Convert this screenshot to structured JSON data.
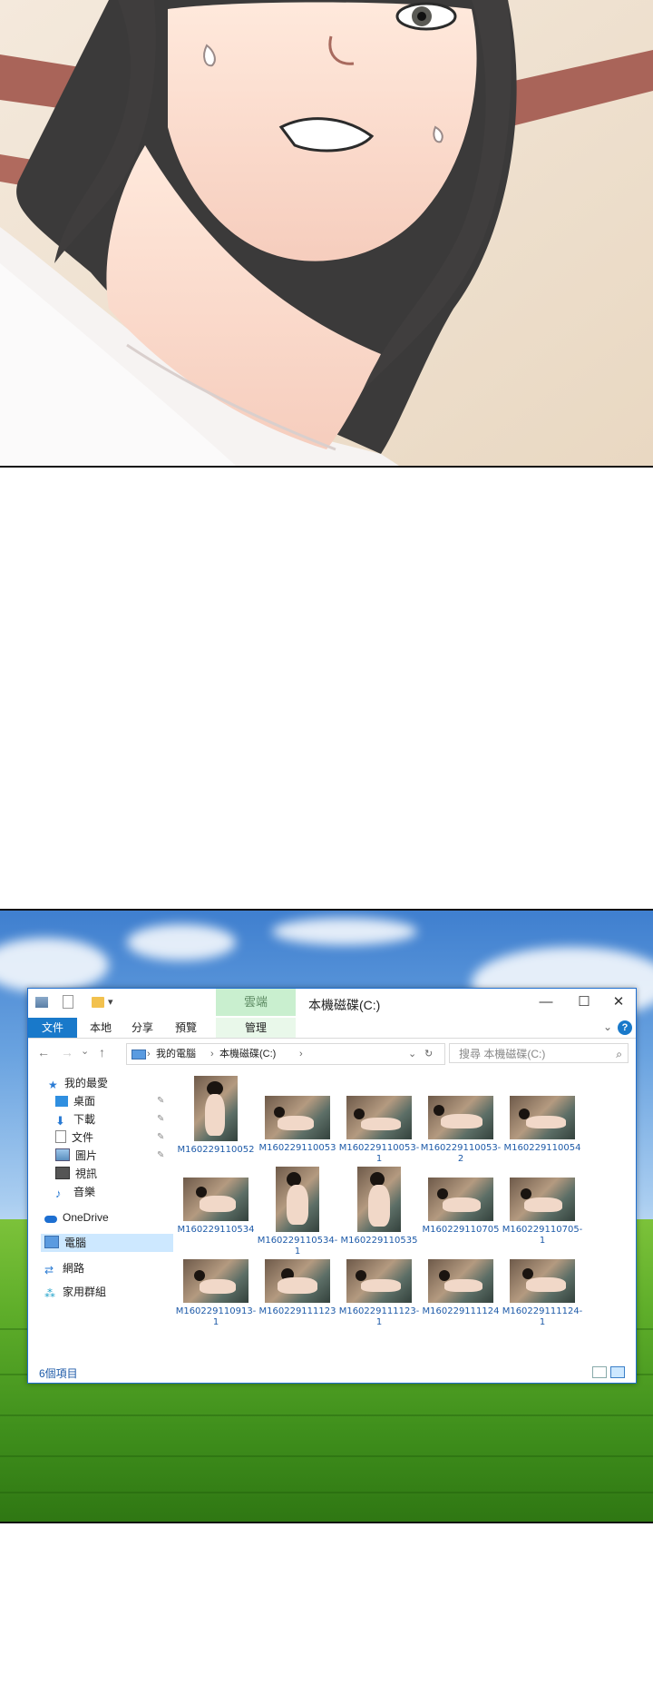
{
  "explorer": {
    "context_tab": "雲端",
    "title": "本機磁碟(C:)",
    "window_buttons": {
      "minimize": "—",
      "maximize": "☐",
      "close": "✕"
    },
    "ribbon_tabs": {
      "file": "文件",
      "home": "本地",
      "share": "分享",
      "view": "預覽",
      "manage": "管理"
    },
    "nav_back": "←",
    "nav_forward": "→",
    "nav_recent": "⌄",
    "nav_up": "↑",
    "breadcrumb": [
      "我的電腦",
      "本機磁碟(C:)"
    ],
    "search_placeholder": "搜尋 本機磁碟(C:)",
    "sidebar": {
      "favorites": "我的最愛",
      "quick": [
        {
          "label": "桌面",
          "icon": "desktop-icon",
          "pinned": true
        },
        {
          "label": "下載",
          "icon": "download-icon",
          "pinned": true
        },
        {
          "label": "文件",
          "icon": "document-icon",
          "pinned": true
        },
        {
          "label": "圖片",
          "icon": "picture-icon",
          "pinned": true
        },
        {
          "label": "視訊",
          "icon": "video-icon",
          "pinned": false
        },
        {
          "label": "音樂",
          "icon": "music-icon",
          "pinned": false
        }
      ],
      "onedrive": "OneDrive",
      "this_pc": "電腦",
      "network": "網路",
      "homegroup": "家用群組"
    },
    "files": [
      {
        "name": "M160229110052",
        "tall": true
      },
      {
        "name": "M160229110053",
        "tall": false
      },
      {
        "name": "M160229110053-1",
        "tall": false
      },
      {
        "name": "M160229110053-2",
        "tall": false
      },
      {
        "name": "M160229110054",
        "tall": false
      },
      {
        "name": "M160229110534",
        "tall": false
      },
      {
        "name": "M160229110534-1",
        "tall": true
      },
      {
        "name": "M160229110535",
        "tall": true
      },
      {
        "name": "M160229110705",
        "tall": false
      },
      {
        "name": "M160229110705-1",
        "tall": false
      },
      {
        "name": "M160229110913-1",
        "tall": false
      },
      {
        "name": "M160229111123",
        "tall": false
      },
      {
        "name": "M160229111123-1",
        "tall": false
      },
      {
        "name": "M160229111124",
        "tall": false
      },
      {
        "name": "M160229111124-1",
        "tall": false
      }
    ],
    "status": "6個項目"
  },
  "colors": {
    "accent": "#1979ca",
    "context_tab": "#c9efcf",
    "link_text": "#1d5aa8"
  }
}
